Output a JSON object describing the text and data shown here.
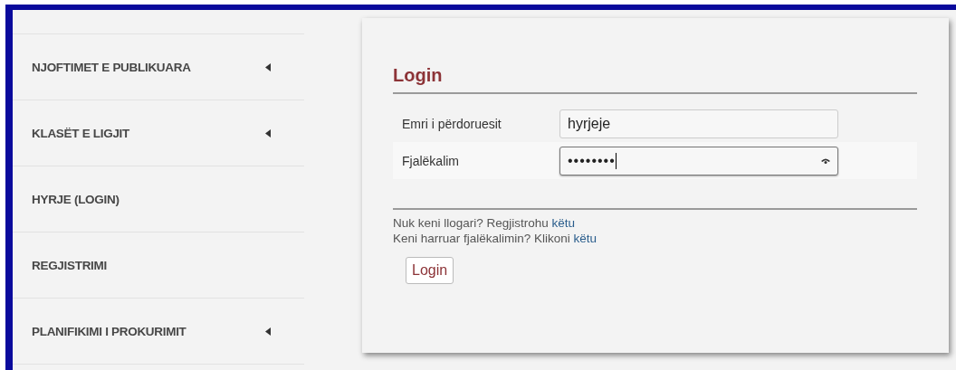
{
  "sidebar": {
    "items": [
      {
        "label": "NJOFTIMET E PUBLIKUARA",
        "has_submenu": true
      },
      {
        "label": "KLASËT E LIGJIT",
        "has_submenu": true
      },
      {
        "label": "HYRJE (LOGIN)",
        "has_submenu": false
      },
      {
        "label": "REGJISTRIMI",
        "has_submenu": false
      },
      {
        "label": "PLANIFIKIMI I PROKURIMIT",
        "has_submenu": true
      }
    ]
  },
  "login": {
    "title": "Login",
    "fields": [
      {
        "kind": "text",
        "label": "Emri i përdoruesit",
        "value": "hyrjeje",
        "focused": false
      },
      {
        "kind": "password",
        "label": "Fjalëkalim",
        "value": "••••••••",
        "focused": true
      }
    ],
    "links": [
      {
        "text": "Nuk keni llogari? Regjistrohu",
        "link": "këtu"
      },
      {
        "text": "Keni harruar fjalëkalimin? Klikoni",
        "link": "këtu"
      }
    ],
    "button": "Login"
  }
}
